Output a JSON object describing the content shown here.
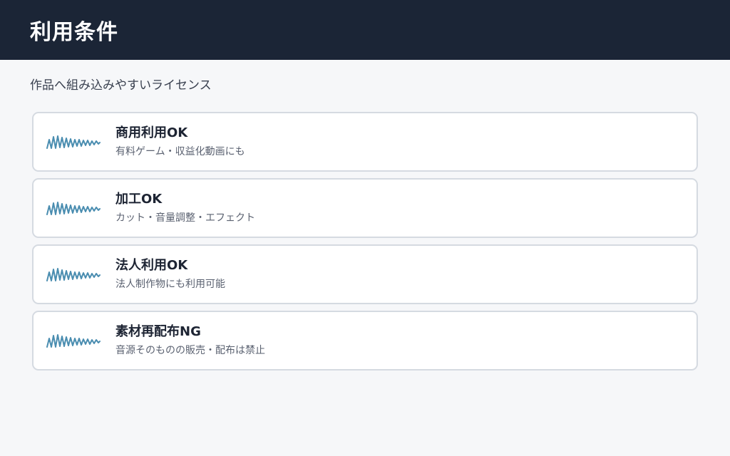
{
  "header": {
    "title": "利用条件"
  },
  "subtitle": "作品へ組み込みやすいライセンス",
  "icons": {
    "card": "waveform-icon",
    "color": "#4a8db0"
  },
  "colors": {
    "header_bg": "#1b2536",
    "page_bg": "#f6f7f9",
    "card_border": "#d5dae1"
  },
  "cards": [
    {
      "title": "商用利用OK",
      "desc": "有料ゲーム・収益化動画にも"
    },
    {
      "title": "加工OK",
      "desc": "カット・音量調整・エフェクト"
    },
    {
      "title": "法人利用OK",
      "desc": "法人制作物にも利用可能"
    },
    {
      "title": "素材再配布NG",
      "desc": "音源そのものの販売・配布は禁止"
    }
  ]
}
